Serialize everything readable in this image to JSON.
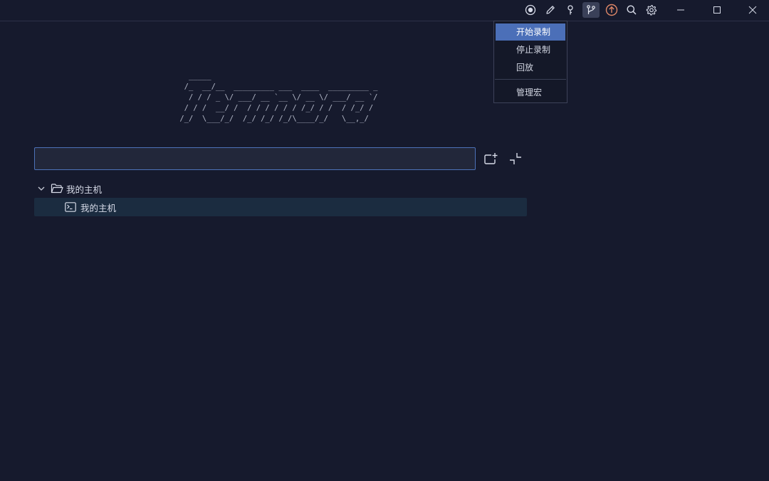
{
  "menu": {
    "items": [
      {
        "label": "开始录制",
        "highlighted": true
      },
      {
        "label": "停止录制"
      },
      {
        "label": "回放"
      },
      {
        "label": "管理宏"
      }
    ]
  },
  "logo": {
    "ascii": "   _____\n  /_  __/__  _________ ___  ____  _________ _\n   / / / _ \\/ ___/ __ `__ \\/ __ \\/ ___/ __ `/\n  / / /  __/ /  / / / / / / /_/ / /  / /_/ /\n /_/  \\___/_/  /_/ /_/ /_/\\____/_/   \\__,_/"
  },
  "search": {
    "value": "",
    "placeholder": ""
  },
  "tree": {
    "group_label": "我的主机",
    "host_label": "我的主机"
  },
  "colors": {
    "background": "#161a2d",
    "accent": "#4b6fb8",
    "update_icon": "#e08868",
    "selected_row": "#1b2c40"
  },
  "icons": [
    "record-icon",
    "edit-icon",
    "key-icon",
    "branch-icon",
    "update-icon",
    "search-icon",
    "settings-icon",
    "minimize-icon",
    "maximize-icon",
    "close-icon",
    "add-folder-icon",
    "collapse-icon",
    "chevron-down-icon",
    "folder-open-icon",
    "terminal-icon"
  ]
}
